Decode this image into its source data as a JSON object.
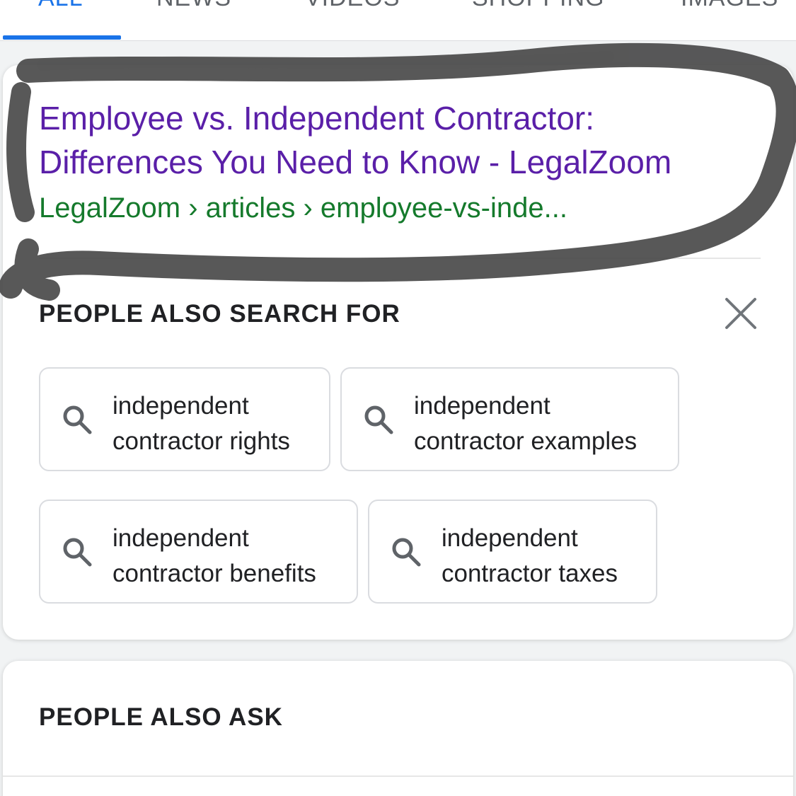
{
  "tabs": [
    {
      "label": "ALL",
      "active": true
    },
    {
      "label": "NEWS",
      "active": false
    },
    {
      "label": "VIDEOS",
      "active": false
    },
    {
      "label": "SHOPPING",
      "active": false
    },
    {
      "label": "IMAGES",
      "active": false
    }
  ],
  "result": {
    "title_line1": "Employee vs. Independent Contractor:",
    "title_line2": "Differences You Need to Know - LegalZoom",
    "breadcrumb": "LegalZoom › articles › employee-vs-inde..."
  },
  "people_also_search": {
    "heading": "PEOPLE ALSO SEARCH FOR",
    "close_icon": "close-icon",
    "chips": [
      {
        "line1": "independent",
        "line2": "contractor rights",
        "icon": "search-icon"
      },
      {
        "line1": "independent",
        "line2": "contractor examples",
        "icon": "search-icon"
      },
      {
        "line1": "independent",
        "line2": "contractor benefits",
        "icon": "search-icon"
      },
      {
        "line1": "independent",
        "line2": "contractor taxes",
        "icon": "search-icon"
      }
    ]
  },
  "people_also_ask": {
    "heading": "PEOPLE ALSO ASK"
  },
  "colors": {
    "active_tab": "#1a73e8",
    "visited_link": "#5a1fa8",
    "url_green": "#157a2c",
    "scribble": "#4a4a4a"
  }
}
